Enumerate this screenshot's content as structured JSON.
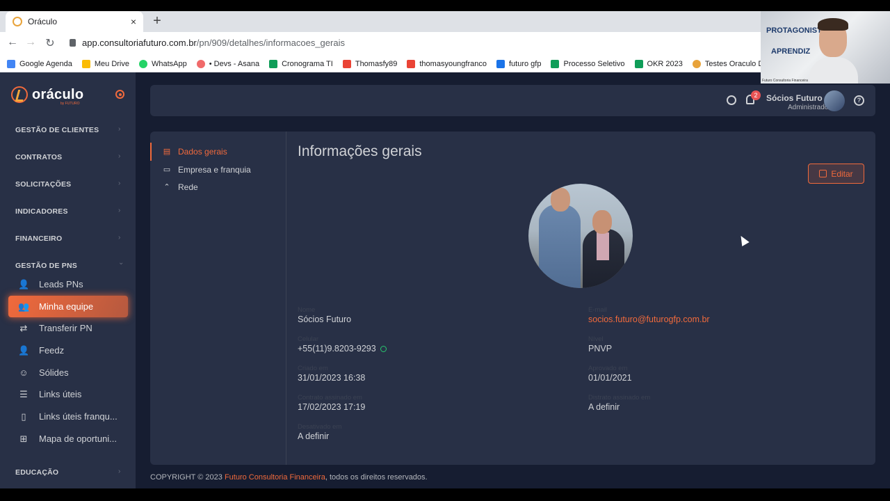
{
  "browser": {
    "tab_title": "Oráculo",
    "tab_close": "×",
    "new_tab": "+",
    "url_host": "app.consultoriafuturo.com.br",
    "url_path": "/pn/909/detalhes/informacoes_gerais",
    "bookmarks": [
      {
        "label": "Google Agenda",
        "color": "#4285f4"
      },
      {
        "label": "Meu Drive",
        "color": "#fbbc04"
      },
      {
        "label": "WhatsApp",
        "color": "#25d366"
      },
      {
        "label": "• Devs - Asana",
        "color": "#f06a6a"
      },
      {
        "label": "Cronograma TI",
        "color": "#0f9d58"
      },
      {
        "label": "Thomasfy89",
        "color": "#ea4335"
      },
      {
        "label": "thomasyoungfranco",
        "color": "#ea4335"
      },
      {
        "label": "futuro gfp",
        "color": "#1a73e8"
      },
      {
        "label": "Processo Seletivo",
        "color": "#0f9d58"
      },
      {
        "label": "OKR 2023",
        "color": "#0f9d58"
      },
      {
        "label": "Testes Oraculo DEV",
        "color": "#e8a33a"
      }
    ]
  },
  "webcam": {
    "word1": "PROTAGONIST",
    "word2": "APRENDIZ",
    "caption": "Futuro Consultoria Financeira"
  },
  "sidebar": {
    "brand_name": "oráculo",
    "brand_sub": "by FUTURO",
    "sections": [
      {
        "label": "GESTÃO DE CLIENTES"
      },
      {
        "label": "CONTRATOS"
      },
      {
        "label": "SOLICITAÇÕES"
      },
      {
        "label": "INDICADORES"
      },
      {
        "label": "FINANCEIRO"
      },
      {
        "label": "GESTÃO DE PNS"
      },
      {
        "label": "EDUCAÇÃO"
      }
    ],
    "items": [
      {
        "label": "Leads PNs",
        "icon": "user-check-icon"
      },
      {
        "label": "Minha equipe",
        "icon": "users-icon"
      },
      {
        "label": "Transferir PN",
        "icon": "repeat-icon"
      },
      {
        "label": "Feedz",
        "icon": "user-check-icon"
      },
      {
        "label": "Sólides",
        "icon": "smile-icon"
      },
      {
        "label": "Links úteis",
        "icon": "list-icon"
      },
      {
        "label": "Links úteis franqu...",
        "icon": "book-icon"
      },
      {
        "label": "Mapa de oportuni...",
        "icon": "map-icon"
      }
    ],
    "chevron": "›",
    "chevron_open": "⌄"
  },
  "header": {
    "notification_count": "2",
    "user_name": "Sócios Futuro",
    "user_role": "Administrador",
    "help_glyph": "?"
  },
  "subnav": {
    "items": [
      {
        "label": "Dados gerais",
        "icon": "file-text-icon"
      },
      {
        "label": "Empresa e franquia",
        "icon": "archive-icon"
      },
      {
        "label": "Rede",
        "icon": "chevrons-up-icon"
      }
    ]
  },
  "main": {
    "title": "Informações gerais",
    "edit_label": "Editar",
    "fields": {
      "nome_label": "Nome",
      "nome_value": "Sócios Futuro",
      "email_label": "E-mail",
      "email_value": "socios.futuro@futurogfp.com.br",
      "celular_label": "Celular",
      "celular_value": "+55(11)9.8203-9293",
      "nivel_label": "Nível",
      "nivel_value": "PNVP",
      "criado_label": "Criado em",
      "criado_value": "31/01/2023 16:38",
      "aprovado_label": "Aprovado em",
      "aprovado_value": "01/01/2021",
      "contrato_label": "Contrato assinado em",
      "contrato_value": "17/02/2023 17:19",
      "distrato_label": "Distrato assinado em",
      "distrato_value": "A definir",
      "desativado_label": "Desativado em",
      "desativado_value": "A definir"
    }
  },
  "footer": {
    "prefix": "COPYRIGHT © 2023",
    "company": "Futuro Consultoria Financeira",
    "suffix": ", todos os direitos reservados."
  },
  "colors": {
    "accent": "#f16a3c",
    "sidebar_bg": "#283046",
    "content_bg": "#161d31"
  }
}
